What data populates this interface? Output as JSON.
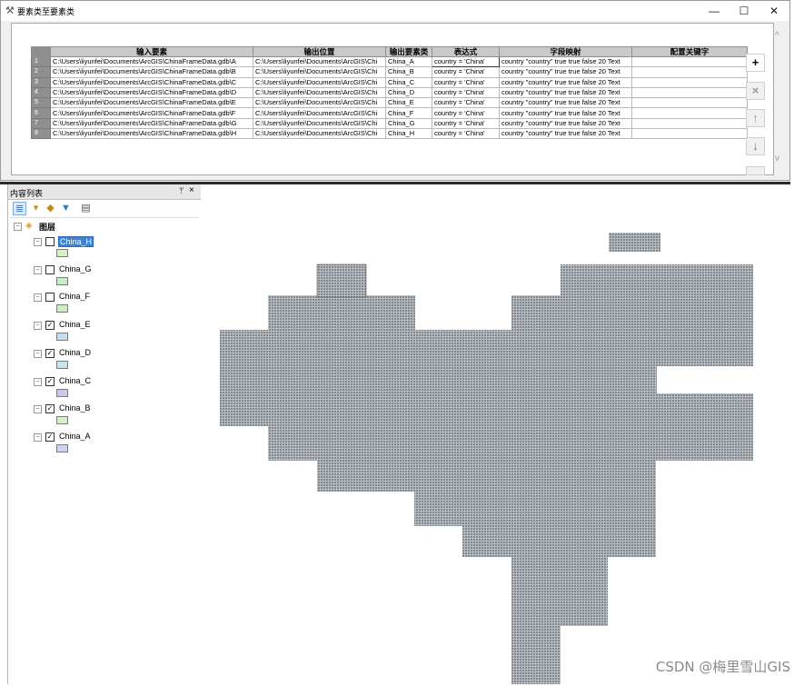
{
  "dialog": {
    "title": "要素类至要素类",
    "minimize": "—",
    "maximize": "☐",
    "close": "✕",
    "columns": [
      "输入要素",
      "输出位置",
      "输出要素类",
      "表达式",
      "字段映射",
      "配置关键字"
    ],
    "rows": [
      {
        "num": "1",
        "input": "C:\\Users\\liyunfei\\Documents\\ArcGIS\\ChinaFrameData.gdb\\A",
        "location": "C:\\Users\\liyunfei\\Documents\\ArcGIS\\Chi",
        "output": "China_A",
        "expression": "country = 'China'",
        "mapping": "country \"country\" true true false 20 Text",
        "keyword": ""
      },
      {
        "num": "2",
        "input": "C:\\Users\\liyunfei\\Documents\\ArcGIS\\ChinaFrameData.gdb\\B",
        "location": "C:\\Users\\liyunfei\\Documents\\ArcGIS\\Chi",
        "output": "China_B",
        "expression": "country = 'China'",
        "mapping": "country \"country\" true true false 20 Text",
        "keyword": ""
      },
      {
        "num": "3",
        "input": "C:\\Users\\liyunfei\\Documents\\ArcGIS\\ChinaFrameData.gdb\\C",
        "location": "C:\\Users\\liyunfei\\Documents\\ArcGIS\\Chi",
        "output": "China_C",
        "expression": "country = 'China'",
        "mapping": "country \"country\" true true false 20 Text",
        "keyword": ""
      },
      {
        "num": "4",
        "input": "C:\\Users\\liyunfei\\Documents\\ArcGIS\\ChinaFrameData.gdb\\D",
        "location": "C:\\Users\\liyunfei\\Documents\\ArcGIS\\Chi",
        "output": "China_D",
        "expression": "country = 'China'",
        "mapping": "country \"country\" true true false 20 Text",
        "keyword": ""
      },
      {
        "num": "5",
        "input": "C:\\Users\\liyunfei\\Documents\\ArcGIS\\ChinaFrameData.gdb\\E",
        "location": "C:\\Users\\liyunfei\\Documents\\ArcGIS\\Chi",
        "output": "China_E",
        "expression": "country = 'China'",
        "mapping": "country \"country\" true true false 20 Text",
        "keyword": ""
      },
      {
        "num": "6",
        "input": "C:\\Users\\liyunfei\\Documents\\ArcGIS\\ChinaFrameData.gdb\\F",
        "location": "C:\\Users\\liyunfei\\Documents\\ArcGIS\\Chi",
        "output": "China_F",
        "expression": "country = 'China'",
        "mapping": "country \"country\" true true false 20 Text",
        "keyword": ""
      },
      {
        "num": "7",
        "input": "C:\\Users\\liyunfei\\Documents\\ArcGIS\\ChinaFrameData.gdb\\G",
        "location": "C:\\Users\\liyunfei\\Documents\\ArcGIS\\Chi",
        "output": "China_G",
        "expression": "country = 'China'",
        "mapping": "country \"country\" true true false 20 Text",
        "keyword": ""
      },
      {
        "num": "8",
        "input": "C:\\Users\\liyunfei\\Documents\\ArcGIS\\ChinaFrameData.gdb\\H",
        "location": "C:\\Users\\liyunfei\\Documents\\ArcGIS\\Chi",
        "output": "China_H",
        "expression": "country = 'China'",
        "mapping": "country \"country\" true true false 20 Text",
        "keyword": ""
      }
    ],
    "side_buttons": {
      "add": "+",
      "remove": "×",
      "up": "↑",
      "down": "↓"
    },
    "scroll": {
      "left": "<",
      "right": ">",
      "up": "^",
      "down": "v"
    }
  },
  "toc": {
    "title": "内容列表",
    "pin": "ᛘ",
    "close": "×",
    "root_label": "图层",
    "layers": [
      {
        "name": "China_H",
        "checked": false,
        "selected": true,
        "swatch": "#d6f0c0"
      },
      {
        "name": "China_G",
        "checked": false,
        "selected": false,
        "swatch": "#c7ecc7"
      },
      {
        "name": "China_F",
        "checked": false,
        "selected": false,
        "swatch": "#cfecc3"
      },
      {
        "name": "China_E",
        "checked": true,
        "selected": false,
        "swatch": "#c6dcf2"
      },
      {
        "name": "China_D",
        "checked": true,
        "selected": false,
        "swatch": "#c3e6f0"
      },
      {
        "name": "China_C",
        "checked": true,
        "selected": false,
        "swatch": "#c9c6ef"
      },
      {
        "name": "China_B",
        "checked": true,
        "selected": false,
        "swatch": "#d3efc6"
      },
      {
        "name": "China_A",
        "checked": true,
        "selected": false,
        "swatch": "#cbd3f1"
      }
    ],
    "toolbar_icons": [
      "list-by-drawing-order-icon",
      "list-by-source-icon",
      "list-by-visibility-icon",
      "list-by-selection-icon",
      "options-icon"
    ]
  },
  "map": {
    "fill_color": "#8e959c",
    "watermark": "CSDN @梅里雪山GIS"
  }
}
